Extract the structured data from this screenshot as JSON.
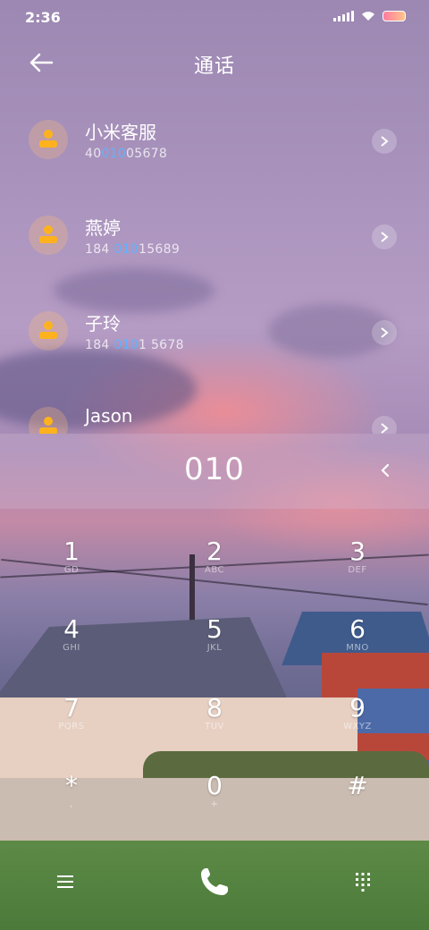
{
  "status_bar": {
    "time": "2:36"
  },
  "header": {
    "title": "通话",
    "back_icon": "back-arrow-icon"
  },
  "contacts": [
    {
      "name": "小米客服",
      "number_pre": "40",
      "number_hl": "010",
      "number_post": "05678"
    },
    {
      "name": "燕婷",
      "number_pre": "184 ",
      "number_hl": "010",
      "number_post": "15689"
    },
    {
      "name": "子玲",
      "number_pre": "184 ",
      "number_hl": "010",
      "number_post": "1 5678"
    },
    {
      "name": "Jason",
      "number_pre": "",
      "number_hl": "",
      "number_post": ""
    }
  ],
  "dial_input": {
    "digits": "010"
  },
  "keypad": [
    {
      "digit": "1",
      "letters": "GD"
    },
    {
      "digit": "2",
      "letters": "ABC"
    },
    {
      "digit": "3",
      "letters": "DEF"
    },
    {
      "digit": "4",
      "letters": "GHI"
    },
    {
      "digit": "5",
      "letters": "JKL"
    },
    {
      "digit": "6",
      "letters": "MNO"
    },
    {
      "digit": "7",
      "letters": "PQRS"
    },
    {
      "digit": "8",
      "letters": "TUV"
    },
    {
      "digit": "9",
      "letters": "WXYZ"
    },
    {
      "digit": "*",
      "letters": ","
    },
    {
      "digit": "0",
      "letters": "+"
    },
    {
      "digit": "#",
      "letters": ""
    }
  ],
  "colors": {
    "highlight": "#5fb3ff",
    "avatar": "#ffb21e"
  },
  "icons": {
    "menu": "menu-icon",
    "call": "phone-icon",
    "dialpad": "dialpad-icon",
    "delete": "backspace-icon"
  }
}
